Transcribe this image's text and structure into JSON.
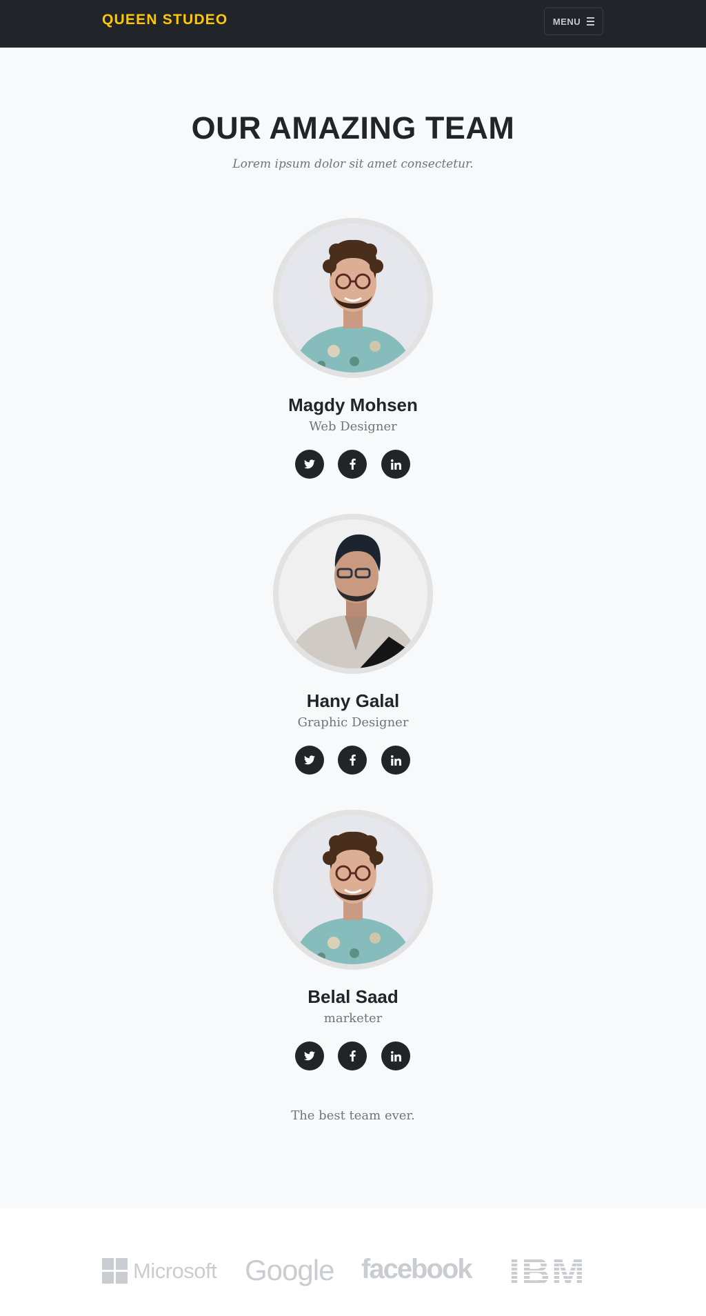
{
  "nav": {
    "brand": "QUEEN STUDEO",
    "menu_label": "MENU"
  },
  "team": {
    "title": "OUR AMAZING TEAM",
    "subtitle": "Lorem ipsum dolor sit amet consectetur.",
    "members": [
      {
        "name": "Magdy Mohsen",
        "role": "Web Designer"
      },
      {
        "name": "Hany Galal",
        "role": "Graphic Designer"
      },
      {
        "name": "Belal Saad",
        "role": "marketer"
      }
    ],
    "social_icons": [
      "twitter-icon",
      "facebook-icon",
      "linkedin-icon"
    ],
    "tagline": "The best team ever."
  },
  "clients": {
    "logos": [
      "Microsoft",
      "Google",
      "facebook",
      "IBM"
    ]
  },
  "colors": {
    "navbar_bg": "#212529",
    "brand": "#ffc800",
    "page_bg": "#f8f9fa",
    "social_bg": "#212529",
    "logo_gray": "#c9cdd2"
  }
}
